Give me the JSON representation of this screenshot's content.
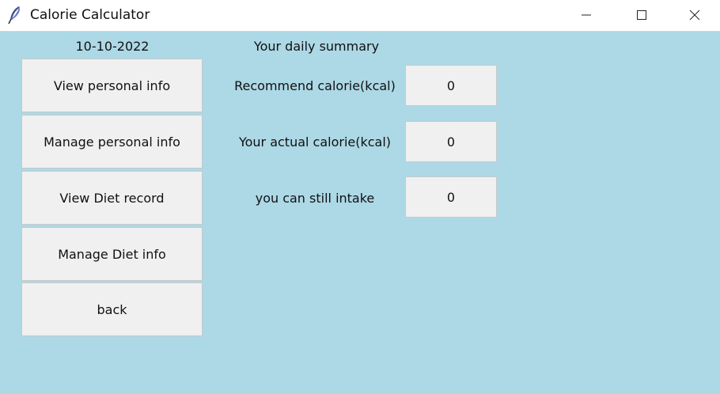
{
  "window": {
    "title": "Calorie Calculator",
    "background": "#add8e6"
  },
  "header": {
    "date": "10-10-2022",
    "summary_title": "Your daily summary"
  },
  "menu": {
    "buttons": [
      {
        "label": "View personal info"
      },
      {
        "label": "Manage personal info"
      },
      {
        "label": "View Diet record"
      },
      {
        "label": "Manage Diet info"
      },
      {
        "label": "back"
      }
    ]
  },
  "summary": {
    "rows": [
      {
        "label": "Recommend calorie(kcal)",
        "value": "0"
      },
      {
        "label": "Your actual calorie(kcal)",
        "value": "0"
      },
      {
        "label": "you can still intake",
        "value": "0"
      }
    ]
  },
  "icons": {
    "app": "feather-icon",
    "minimize": "minimize-icon",
    "maximize": "maximize-icon",
    "close": "close-icon"
  }
}
